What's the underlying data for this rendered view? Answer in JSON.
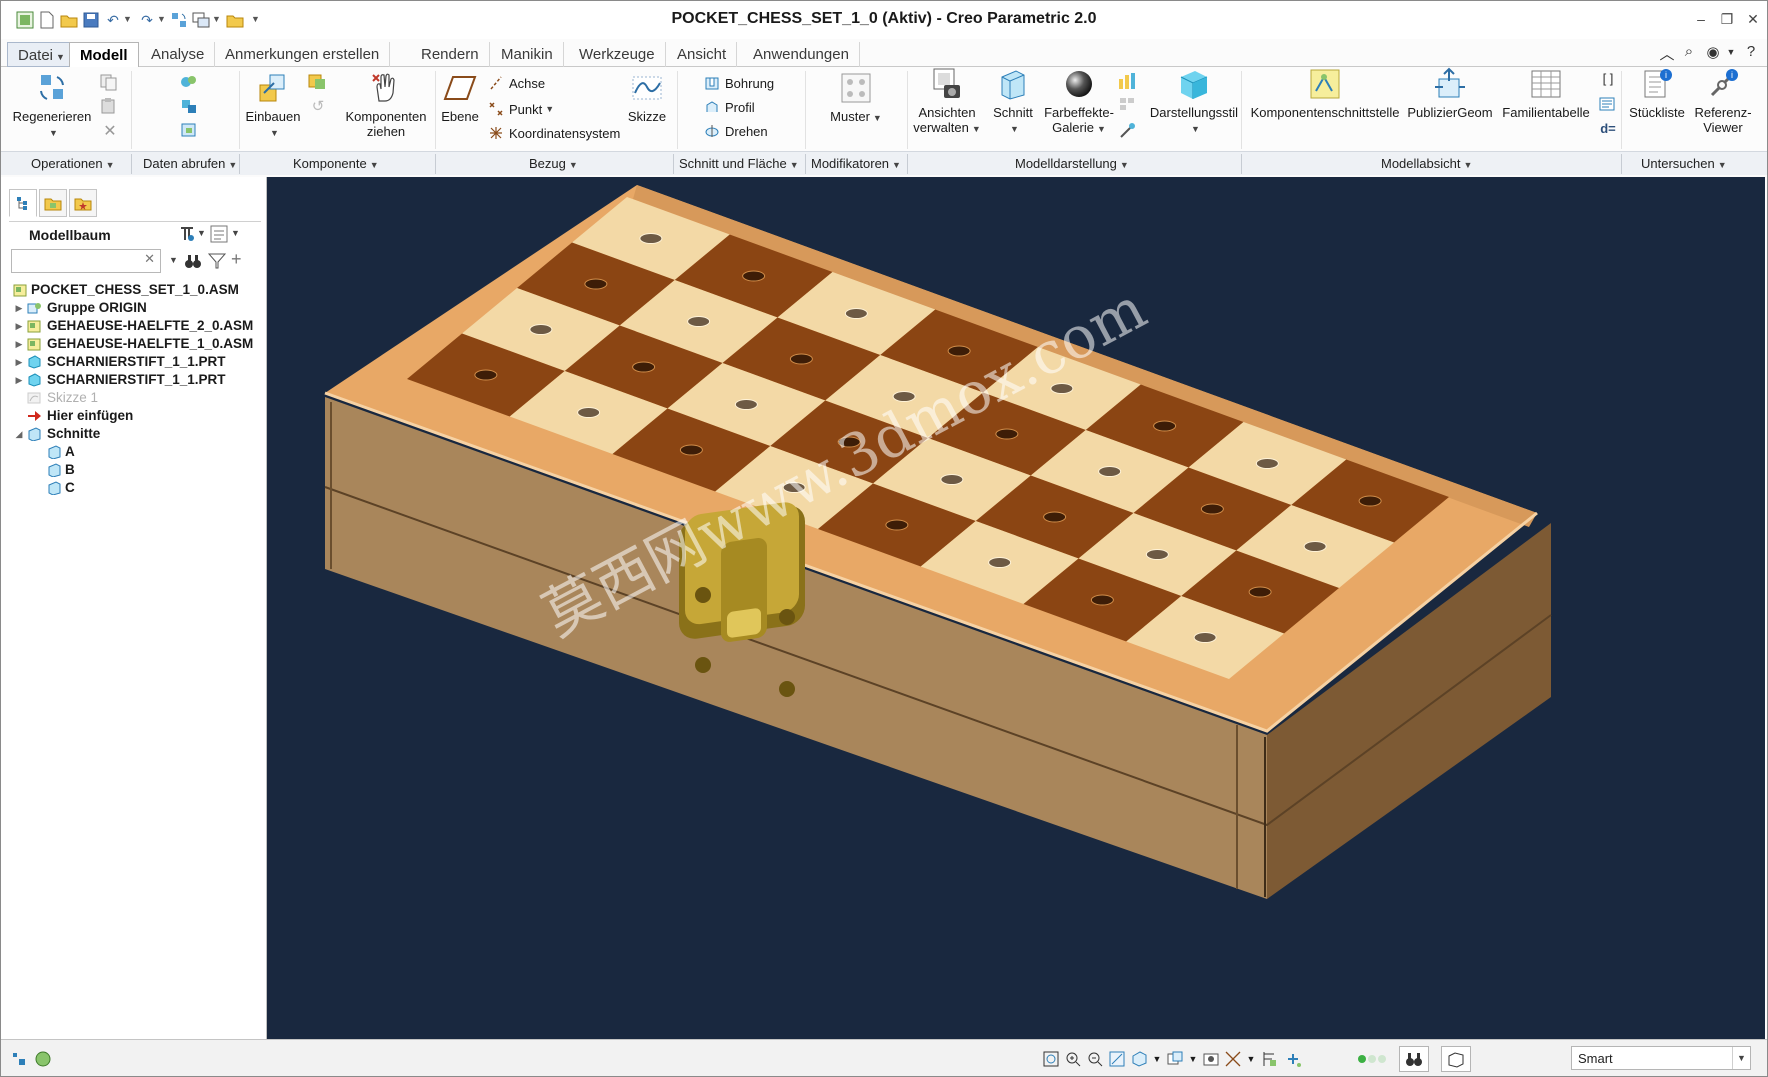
{
  "window": {
    "title": "POCKET_CHESS_SET_1_0 (Aktiv) - Creo Parametric 2.0"
  },
  "tabs": [
    {
      "label": "Datei",
      "active": false,
      "file": true
    },
    {
      "label": "Modell",
      "active": true
    },
    {
      "label": "Analyse"
    },
    {
      "label": "Anmerkungen erstellen"
    },
    {
      "label": "Rendern"
    },
    {
      "label": "Manikin"
    },
    {
      "label": "Werkzeuge"
    },
    {
      "label": "Ansicht"
    },
    {
      "label": "Anwendungen"
    }
  ],
  "ribbon": {
    "regenerieren": "Regenerieren",
    "einbauen": "Einbauen",
    "komponenten_ziehen_1": "Komponenten",
    "komponenten_ziehen_2": "ziehen",
    "ebene": "Ebene",
    "achse": "Achse",
    "punkt": "Punkt",
    "koordinatensystem": "Koordinatensystem",
    "skizze": "Skizze",
    "bohrung": "Bohrung",
    "profil": "Profil",
    "drehen": "Drehen",
    "muster": "Muster",
    "ansichten_verwalten_1": "Ansichten",
    "ansichten_verwalten_2": "verwalten",
    "schnitt": "Schnitt",
    "farbeffekte_1": "Farbeffekte-",
    "farbeffekte_2": "Galerie",
    "darstellungsstil": "Darstellungsstil",
    "komponentenschnittstelle": "Komponentenschnittstelle",
    "publiziergeom": "PublizierGeom",
    "familientabelle": "Familientabelle",
    "stueckliste": "Stückliste",
    "referenz_viewer_1": "Referenz-",
    "referenz_viewer_2": "Viewer"
  },
  "groups": [
    "Operationen",
    "Daten abrufen",
    "Komponente",
    "Bezug",
    "Schnitt und Fläche",
    "Modifikatoren",
    "Modelldarstellung",
    "Modellabsicht",
    "Untersuchen"
  ],
  "model_tree": {
    "title": "Modellbaum",
    "search_value": "",
    "items": [
      {
        "label": "POCKET_CHESS_SET_1_0.ASM",
        "icon": "assembly-icon",
        "level": 0,
        "expander": ""
      },
      {
        "label": "Gruppe ORIGIN",
        "icon": "group-icon",
        "level": 1,
        "expander": "▶"
      },
      {
        "label": "GEHAEUSE-HAELFTE_2_0.ASM",
        "icon": "assembly-icon",
        "level": 1,
        "expander": "▶"
      },
      {
        "label": "GEHAEUSE-HAELFTE_1_0.ASM",
        "icon": "assembly-icon",
        "level": 1,
        "expander": "▶"
      },
      {
        "label": "SCHARNIERSTIFT_1_1.PRT",
        "icon": "part-icon",
        "level": 1,
        "expander": "▶"
      },
      {
        "label": "SCHARNIERSTIFT_1_1.PRT",
        "icon": "part-icon",
        "level": 1,
        "expander": "▶"
      },
      {
        "label": "Skizze 1",
        "icon": "sketch-icon",
        "level": 1,
        "expander": "",
        "dim": true
      },
      {
        "label": "Hier einfügen",
        "icon": "insert-arrow-icon",
        "level": 1,
        "expander": ""
      },
      {
        "label": "Schnitte",
        "icon": "section-folder-icon",
        "level": 1,
        "expander": "◢"
      },
      {
        "label": "A",
        "icon": "section-icon",
        "level": 2,
        "expander": ""
      },
      {
        "label": "B",
        "icon": "section-icon",
        "level": 2,
        "expander": ""
      },
      {
        "label": "C",
        "icon": "section-icon",
        "level": 2,
        "expander": ""
      }
    ]
  },
  "viewport": {
    "background": "#19283f",
    "watermark": "莫西网www.3dmox.com"
  },
  "statusbar": {
    "filter_value": "Smart"
  },
  "colors": {
    "dark_square": "#8b4513",
    "light_square": "#f3d9a6",
    "wood_side": "#a9865b",
    "wood_border": "#e39f5d",
    "brass": "#b39424"
  }
}
